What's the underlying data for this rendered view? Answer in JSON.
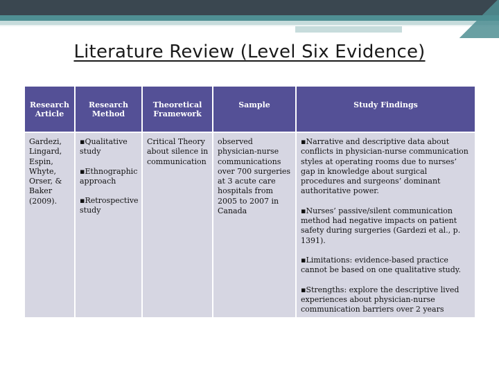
{
  "slide": {
    "title": "Literature Review (Level Six Evidence)"
  },
  "table": {
    "headers": {
      "article": "Research Article",
      "method": "Research Method",
      "framework": "Theoretical Framework",
      "sample": "Sample",
      "findings": "Study Findings"
    },
    "row": {
      "article": "Gardezi, Lingard, Espin, Whyte, Orser, & Baker (2009).",
      "method": [
        "▪Qualitative study",
        "▪Ethnographic approach",
        "▪Retrospective study"
      ],
      "framework": "Critical Theory about silence in communication",
      "sample": "observed physician-nurse communications over 700 surgeries at 3 acute care hospitals from 2005 to 2007 in Canada",
      "findings": [
        "▪Narrative and descriptive data about conflicts in physician-nurse communication styles at operating rooms due to nurses’ gap in knowledge about surgical procedures and surgeons’ dominant authoritative power.",
        "▪Nurses’ passive/silent communication method had negative impacts on patient safety during surgeries (Gardezi et al., p. 1391).",
        "▪Limitations: evidence-based practice cannot be based on one qualitative study.",
        "▪Strengths: explore the descriptive lived experiences about physician-nurse communication barriers over 2 years"
      ]
    }
  },
  "colors": {
    "header_bg": "#545096",
    "cell_bg": "#d6d6e2",
    "band_dark": "#3a4750",
    "band_teal": "#4f8f93"
  }
}
